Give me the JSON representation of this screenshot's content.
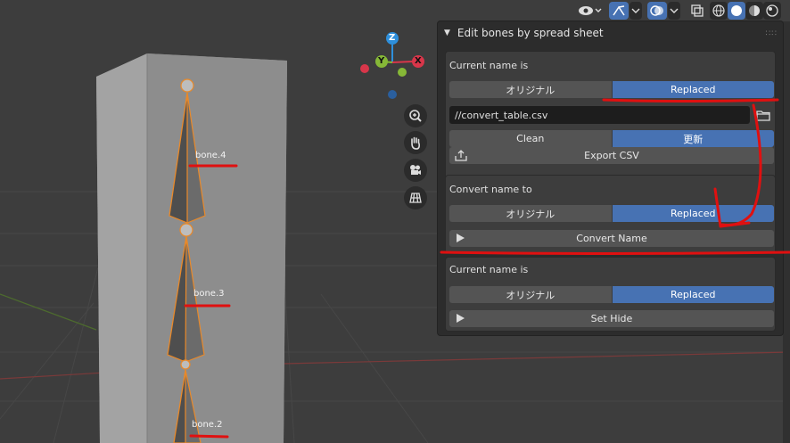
{
  "panel": {
    "title": "Edit bones by spread sheet",
    "section1": {
      "label": "Current name is",
      "option_off": "オリジナル",
      "option_on": "Replaced",
      "file_path": "//convert_table.csv",
      "clean_label": "Clean",
      "update_label": "更新",
      "export_label": "Export CSV"
    },
    "section2": {
      "label": "Convert name to",
      "option_off": "オリジナル",
      "option_on": "Replaced",
      "convert_label": "Convert Name"
    },
    "section3": {
      "label": "Current name is",
      "option_off": "オリジナル",
      "option_on": "Replaced",
      "hide_label": "Set Hide"
    }
  },
  "viewport": {
    "bones": [
      "bone.4",
      "bone.3",
      "bone.2"
    ],
    "gizmo": {
      "z": "Z",
      "y": "Y",
      "x": "X"
    }
  },
  "colors": {
    "accent": "#4772b3",
    "annotation": "#e01010",
    "bone_outline": "#e8892a"
  },
  "icons": [
    "view-object-types-icon",
    "gizmo-toggle-icon",
    "overlay-icon",
    "xray-icon",
    "wireframe-shading-icon",
    "solid-shading-icon",
    "material-shading-icon",
    "rendered-shading-icon",
    "zoom-icon",
    "pan-hand-icon",
    "camera-icon",
    "ortho-grid-icon",
    "folder-icon",
    "export-icon",
    "play-icon"
  ]
}
